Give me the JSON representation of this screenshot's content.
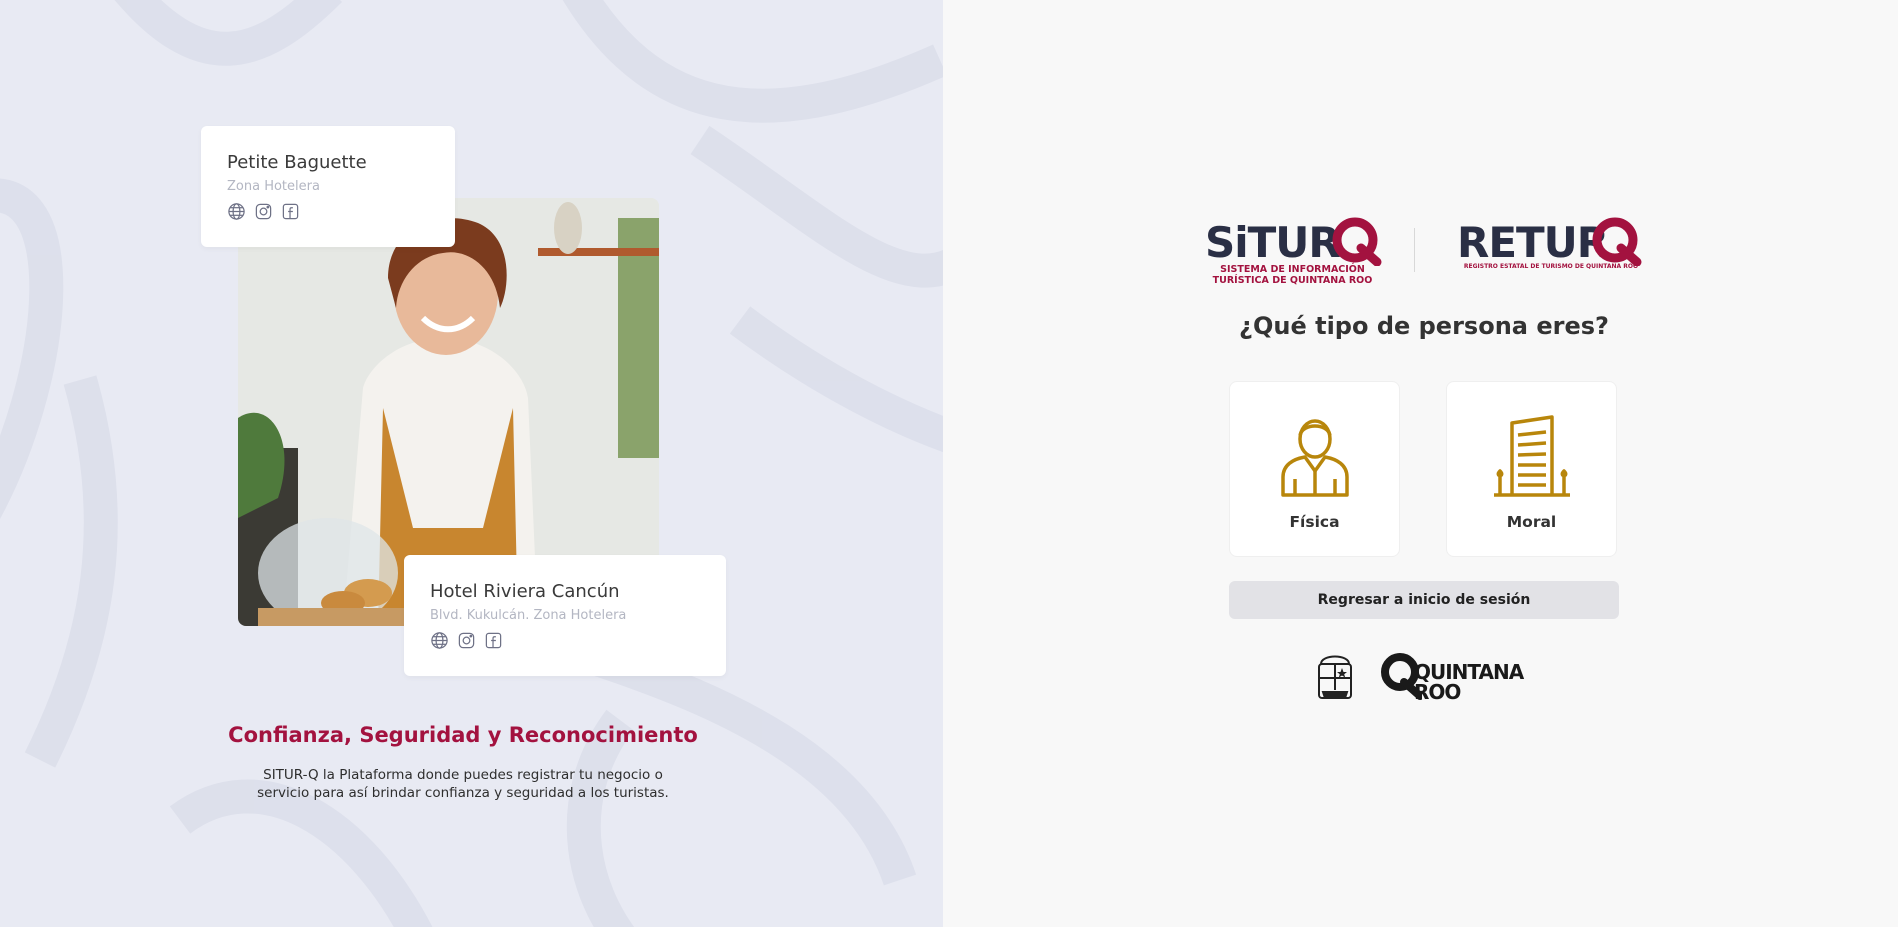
{
  "left": {
    "card1": {
      "name": "Petite Baguette",
      "location": "Zona Hotelera",
      "icons": [
        "globe-icon",
        "instagram-icon",
        "facebook-icon"
      ]
    },
    "card2": {
      "name": "Hotel Riviera Cancún",
      "location": "Blvd. Kukulcán. Zona Hotelera",
      "icons": [
        "globe-icon",
        "instagram-icon",
        "facebook-icon"
      ]
    },
    "tagline": "Confianza, Seguridad y Reconocimiento",
    "description_line1": "SITUR-Q la Plataforma donde puedes registrar tu negocio o",
    "description_line2": "servicio para así brindar confianza y seguridad a los turistas."
  },
  "right": {
    "logo_situr": {
      "title": "SiTUR",
      "subtitle_line1": "SISTEMA DE INFORMACIÓN",
      "subtitle_line2": "TURÍSTICA DE QUINTANA ROO"
    },
    "logo_retur": {
      "title": "RETUR",
      "subtitle": "REGISTRO ESTATAL DE TURISMO DE QUINTANA ROO"
    },
    "question": "¿Qué tipo de persona eres?",
    "options": [
      {
        "label": "Física",
        "icon": "person-icon"
      },
      {
        "label": "Moral",
        "icon": "building-icon"
      }
    ],
    "back_button": "Regresar a inicio de sesión",
    "footer_logo": {
      "line1": "QUINTANA",
      "line2": "ROO"
    }
  },
  "colors": {
    "brand_red": "#a3123f",
    "brand_navy": "#2a2f45",
    "icon_gold": "#b8860b",
    "left_bg": "#e8eaf3"
  }
}
